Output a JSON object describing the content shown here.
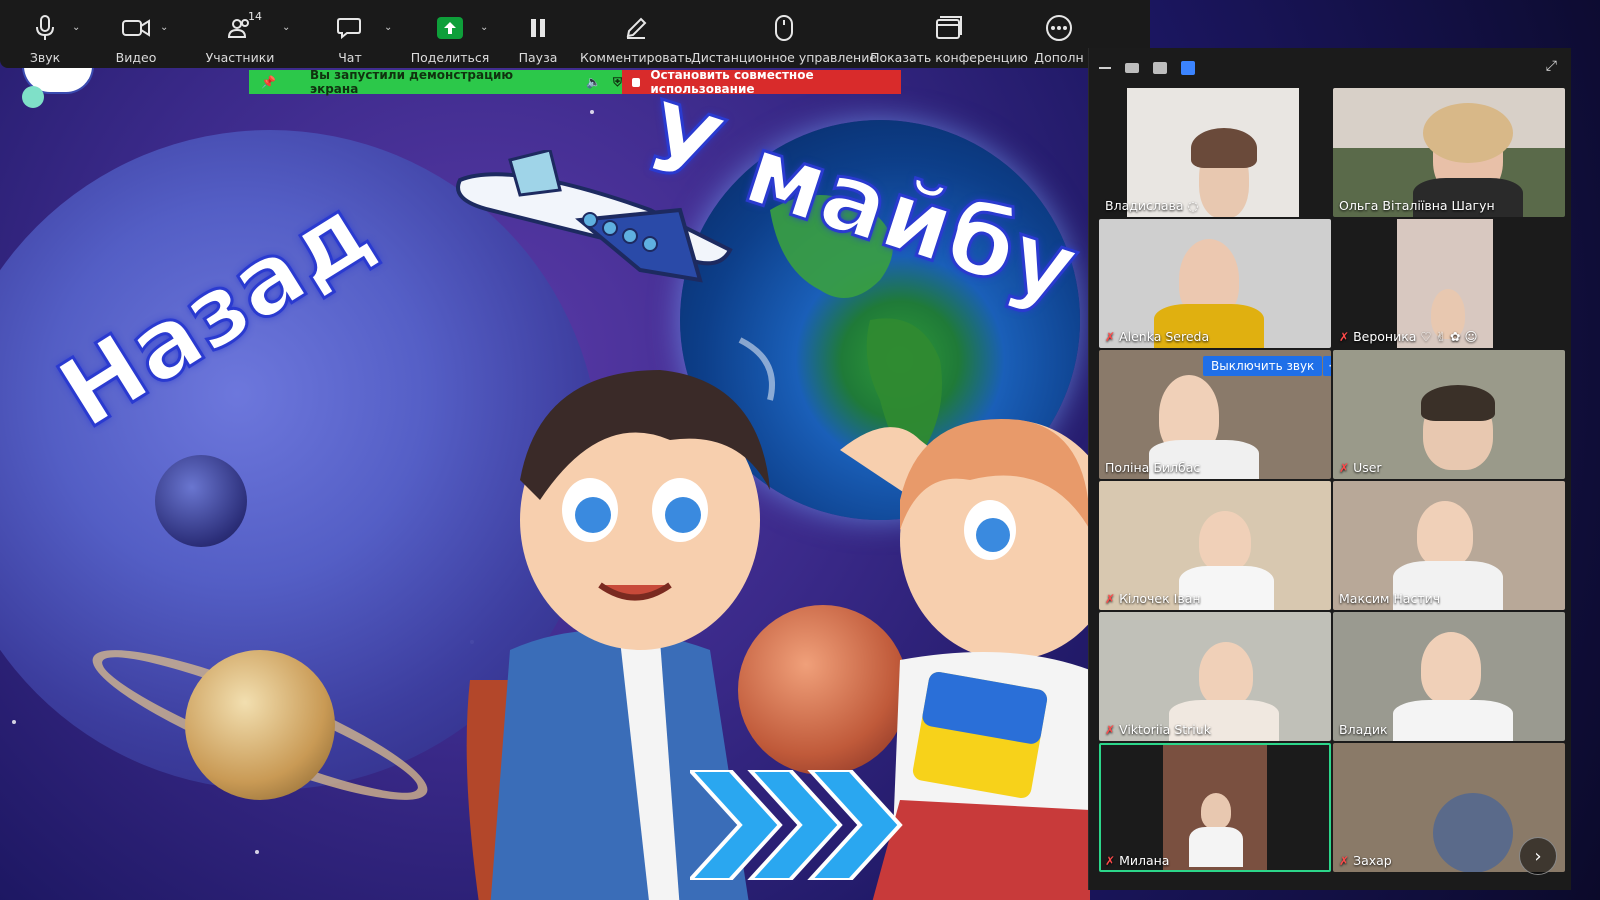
{
  "toolbar": {
    "audio_label": "Звук",
    "video_label": "Видео",
    "participants_label": "Участники",
    "participants_count": "14",
    "chat_label": "Чат",
    "share_label": "Поделиться",
    "pause_label": "Пауза",
    "annotate_label": "Комментировать",
    "remote_label": "Дистанционное управление",
    "show_meeting_label": "Показать конференцию",
    "more_label": "Дополн"
  },
  "share_banner": {
    "status_text": "Вы запустили демонстрацию экрана",
    "stop_label": "Остановить совместное использование",
    "green_color": "#2cc84a",
    "red_color": "#d92b2b"
  },
  "slide": {
    "left_text": "Назад",
    "right_text": "У майбу"
  },
  "participants": [
    {
      "name": "Владислава",
      "muted": false,
      "extra": "◌"
    },
    {
      "name": "Ольга Віталіївна Шагун",
      "muted": false,
      "extra": ""
    },
    {
      "name": "Alenka Sereda",
      "muted": true,
      "extra": ""
    },
    {
      "name": "Вероника",
      "muted": true,
      "extra": "♡ ✌ ✿ ☺"
    },
    {
      "name": "Поліна Билбас",
      "muted": false,
      "extra": ""
    },
    {
      "name": "User",
      "muted": true,
      "extra": ""
    },
    {
      "name": "Кілочек Іван",
      "muted": true,
      "extra": ""
    },
    {
      "name": "Максим  Настич",
      "muted": false,
      "extra": ""
    },
    {
      "name": "Viktoriia Striuk",
      "muted": true,
      "extra": ""
    },
    {
      "name": "Владик",
      "muted": false,
      "extra": ""
    },
    {
      "name": "Милана",
      "muted": true,
      "extra": ""
    },
    {
      "name": "Захар",
      "muted": true,
      "extra": ""
    }
  ],
  "tile_hover": {
    "mute_button": "Выключить звук",
    "more_button": "···"
  },
  "icons": {
    "mic": "mic-icon",
    "camera": "camera-icon",
    "participants": "participants-icon",
    "chat": "chat-icon",
    "share": "share-screen-icon",
    "pause": "pause-icon",
    "annotate": "pencil-icon",
    "remote": "mouse-icon",
    "show_meeting": "window-icon",
    "more": "more-dots-icon",
    "next_page": "chevron-right-icon",
    "fullscreen": "expand-icon"
  },
  "accent_color": "#3b84ff"
}
